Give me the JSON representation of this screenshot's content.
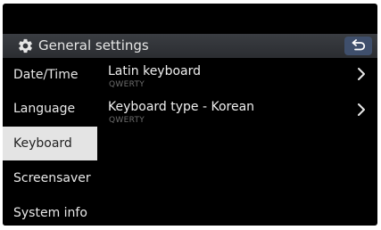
{
  "header": {
    "icon": "gear-icon",
    "title": "General settings",
    "back_icon": "back-arrow-icon"
  },
  "sidebar": {
    "selected_index": 2,
    "items": [
      {
        "label": "Date/Time"
      },
      {
        "label": "Language"
      },
      {
        "label": "Keyboard"
      },
      {
        "label": "Screensaver"
      },
      {
        "label": "System info"
      }
    ]
  },
  "content": {
    "rows": [
      {
        "title": "Latin keyboard",
        "value": "QWERTY",
        "icon": "chevron-right-icon"
      },
      {
        "title": "Keyboard type - Korean",
        "value": "QWERTY",
        "icon": "chevron-right-icon"
      }
    ]
  },
  "colors": {
    "background": "#000000",
    "header": "#2f3236",
    "back_button": "#3f4f6c",
    "selected_item": "#e4e4e4",
    "secondary_text": "#6d6d6d"
  }
}
